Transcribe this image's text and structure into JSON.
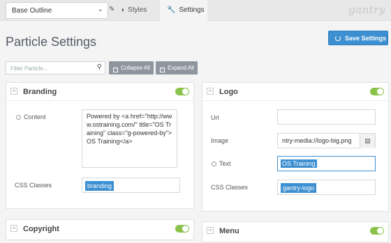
{
  "topbar": {
    "outline_value": "Base Outline",
    "tabs": [
      {
        "label": "Styles"
      },
      {
        "label": "Settings"
      }
    ],
    "logo": "gantry"
  },
  "page": {
    "title": "Particle Settings",
    "save_label": "Save Settings"
  },
  "filter": {
    "placeholder": "Filter Particle...",
    "collapse_label": "Collapse All",
    "expand_label": "Expand All"
  },
  "cards": {
    "branding": {
      "title": "Branding",
      "content_label": "Content",
      "content_value": "Powered by <a href=\"http://www.ostraining.com/\" title=\"OS Training\" class=\"g-powered-by\">OS Training</a>",
      "css_label": "CSS Classes",
      "css_value": "branding"
    },
    "logo": {
      "title": "Logo",
      "url_label": "Url",
      "url_value": "",
      "image_label": "Image",
      "image_value": "ntry-media://logo-big.png",
      "text_label": "Text",
      "text_value": "OS Training",
      "css_label": "CSS Classes",
      "css_value": "gantry-logo"
    },
    "copyright": {
      "title": "Copyright"
    },
    "menu": {
      "title": "Menu"
    }
  },
  "colors": {
    "accent": "#3c8fd1",
    "toggle_on": "#8bc34a",
    "gray_button": "#8f96a0"
  }
}
